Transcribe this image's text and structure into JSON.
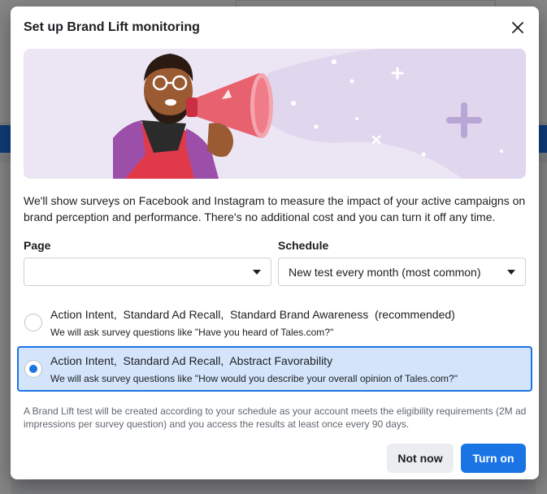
{
  "dialog": {
    "title": "Set up Brand Lift monitoring",
    "description": "We'll show surveys on Facebook and Instagram to measure the impact of your active campaigns on brand perception and performance. There's no additional cost and you can turn it off any time.",
    "footnote": "A Brand Lift test will be created according to your schedule as your account meets the eligibility requirements (2M ad impressions per survey question) and you access the results at least once every 90 days."
  },
  "form": {
    "page": {
      "label": "Page",
      "value": ""
    },
    "schedule": {
      "label": "Schedule",
      "value": "New test every month (most common)"
    }
  },
  "options": [
    {
      "title": "Action Intent,  Standard Ad Recall,  Standard Brand Awareness  (recommended)",
      "subtitle": "We will ask survey questions like \"Have you heard of Tales.com?\"",
      "selected": false
    },
    {
      "title": "Action Intent,  Standard Ad Recall,  Abstract Favorability",
      "subtitle": "We will ask survey questions like \"How would you describe your overall opinion of Tales.com?\"",
      "selected": true
    }
  ],
  "buttons": {
    "secondary": "Not now",
    "primary": "Turn on"
  },
  "icons": {
    "close": "close-icon",
    "dropdown": "chevron-down-icon"
  },
  "colors": {
    "primary": "#1b74e4",
    "selected_bg": "#d4e5fb",
    "banner_bg": "#ece6f4"
  }
}
